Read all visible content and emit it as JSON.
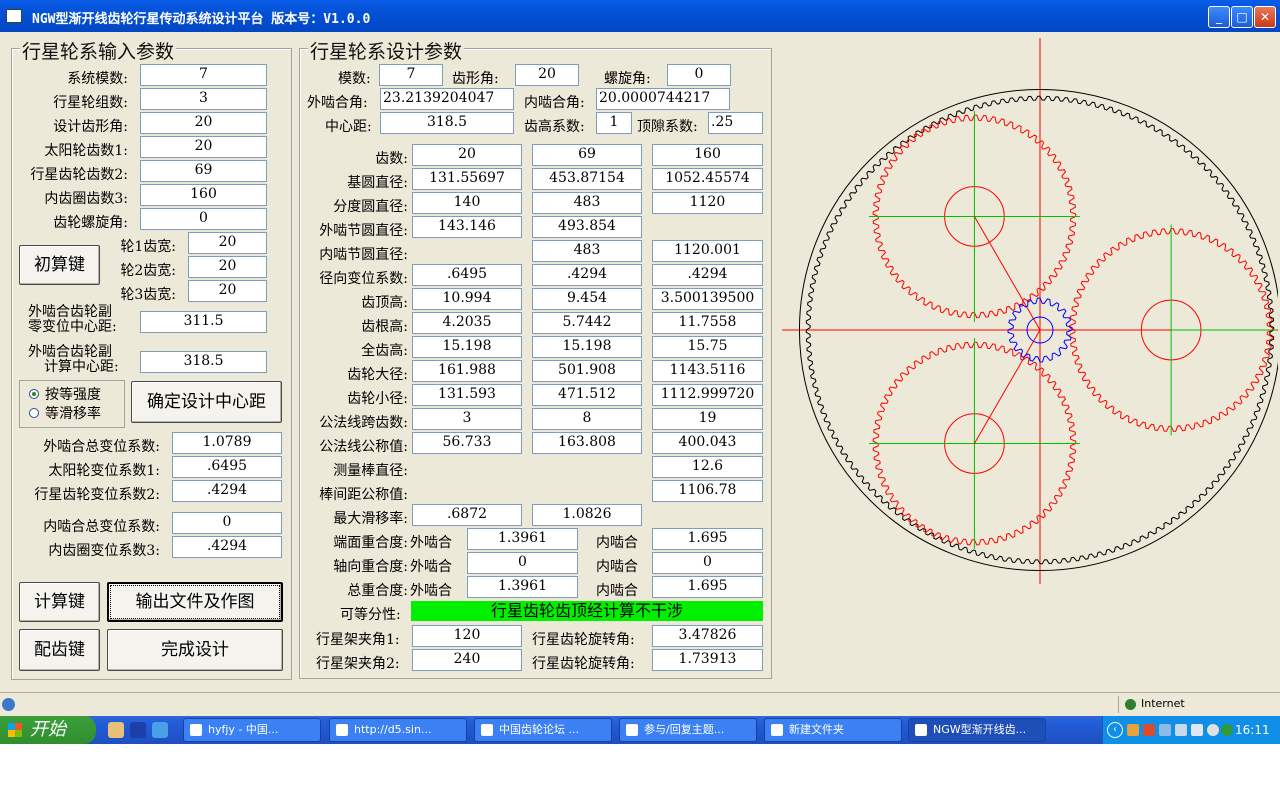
{
  "window": {
    "title": "NGW型渐开线齿轮行星传动系统设计平台   版本号：V1.0.0",
    "controls": {
      "minimize": "_",
      "maximize": "□",
      "close": "✕"
    }
  },
  "input_group": {
    "title": "行星轮系输入参数",
    "rows": [
      {
        "label": "系统模数:",
        "value": "7"
      },
      {
        "label": "行星轮组数:",
        "value": "3"
      },
      {
        "label": "设计齿形角:",
        "value": "20"
      },
      {
        "label": "太阳轮齿数1:",
        "value": "20"
      },
      {
        "label": "行星齿轮齿数2:",
        "value": "69"
      },
      {
        "label": "内齿圈齿数3:",
        "value": "160"
      },
      {
        "label": "齿轮螺旋角:",
        "value": "0"
      }
    ],
    "init_button": "初算键",
    "widths": [
      {
        "label": "轮1齿宽:",
        "value": "20"
      },
      {
        "label": "轮2齿宽:",
        "value": "20"
      },
      {
        "label": "轮3齿宽:",
        "value": "20"
      }
    ],
    "zero_center": {
      "label1": "外啮合齿轮副",
      "label2": "零变位中心距:",
      "value": "311.5"
    },
    "calc_center": {
      "label1": "外啮合齿轮副",
      "label2": "计算中心距:",
      "value": "318.5"
    },
    "radio_equal_strength": "按等强度",
    "radio_equal_slip": "等滑移率",
    "confirm_center_button": "确定设计中心距",
    "ext_total_shift": {
      "label": "外啮合总变位系数:",
      "value": "1.0789"
    },
    "sun_shift": {
      "label": "太阳轮变位系数1:",
      "value": ".6495"
    },
    "planet_shift": {
      "label": "行星齿轮变位系数2:",
      "value": ".4294"
    },
    "int_total_shift": {
      "label": "内啮合总变位系数:",
      "value": "0"
    },
    "ring_shift": {
      "label": "内齿圈变位系数3:",
      "value": ".4294"
    },
    "calc_button": "计算键",
    "output_button": "输出文件及作图",
    "match_button": "配齿键",
    "finish_button": "完成设计"
  },
  "design_group": {
    "title": "行星轮系设计参数",
    "module": {
      "label": "模数:",
      "value": "7"
    },
    "pressure_angle": {
      "label": "齿形角:",
      "value": "20"
    },
    "helix_angle": {
      "label": "螺旋角:",
      "value": "0"
    },
    "ext_mesh_angle": {
      "label": "外啮合角:",
      "value": "23.2139204047"
    },
    "int_mesh_angle": {
      "label": "内啮合角:",
      "value": "20.0000744217"
    },
    "center_distance": {
      "label": "中心距:",
      "value": "318.5"
    },
    "addendum_coef": {
      "label": "齿高系数:",
      "value": "1"
    },
    "clearance_coef": {
      "label": "顶隙系数:",
      "value": ".25"
    },
    "table": [
      {
        "label": "齿数:",
        "v": [
          "20",
          "69",
          "160"
        ]
      },
      {
        "label": "基圆直径:",
        "v": [
          "131.55697",
          "453.87154",
          "1052.45574"
        ]
      },
      {
        "label": "分度圆直径:",
        "v": [
          "140",
          "483",
          "1120"
        ]
      },
      {
        "label": "外啮节圆直径:",
        "v": [
          "143.146",
          "493.854",
          ""
        ]
      },
      {
        "label": "内啮节圆直径:",
        "v": [
          "",
          "483",
          "1120.001"
        ]
      },
      {
        "label": "径向变位系数:",
        "v": [
          ".6495",
          ".4294",
          ".4294"
        ]
      },
      {
        "label": "齿顶高:",
        "v": [
          "10.994",
          "9.454",
          "3.500139500"
        ]
      },
      {
        "label": "齿根高:",
        "v": [
          "4.2035",
          "5.7442",
          "11.7558"
        ]
      },
      {
        "label": "全齿高:",
        "v": [
          "15.198",
          "15.198",
          "15.75"
        ]
      },
      {
        "label": "齿轮大径:",
        "v": [
          "161.988",
          "501.908",
          "1143.5116"
        ]
      },
      {
        "label": "齿轮小径:",
        "v": [
          "131.593",
          "471.512",
          "1112.999720"
        ]
      },
      {
        "label": "公法线跨齿数:",
        "v": [
          "3",
          "8",
          "19"
        ]
      },
      {
        "label": "公法线公称值:",
        "v": [
          "56.733",
          "163.808",
          "400.043"
        ]
      },
      {
        "label": "测量棒直径:",
        "v": [
          "",
          "",
          "12.6"
        ]
      },
      {
        "label": "棒间距公称值:",
        "v": [
          "",
          "",
          "1106.78"
        ]
      },
      {
        "label": "最大滑移率:",
        "v": [
          ".6872",
          "1.0826",
          ""
        ]
      }
    ],
    "contact_rows": [
      {
        "label": "端面重合度:",
        "ext_label": "外啮合",
        "ext": "1.3961",
        "int_label": "内啮合",
        "int": "1.695"
      },
      {
        "label": "轴向重合度:",
        "ext_label": "外啮合",
        "ext": "0",
        "int_label": "内啮合",
        "int": "0"
      },
      {
        "label": "总重合度:",
        "ext_label": "外啮合",
        "ext": "1.3961",
        "int_label": "内啮合",
        "int": "1.695"
      }
    ],
    "divisibility_label": "可等分性:",
    "divisibility_result": "行星齿轮齿顶经计算不干涉",
    "carrier_angle1": {
      "label": "行星架夹角1:",
      "value": "120"
    },
    "carrier_angle2": {
      "label": "行星架夹角2:",
      "value": "240"
    },
    "planet_rot1": {
      "label": "行星齿轮旋转角:",
      "value": "3.47826"
    },
    "planet_rot2": {
      "label": "行星齿轮旋转角:",
      "value": "1.73913"
    }
  },
  "drawing": {
    "sun_teeth": 20,
    "planet_teeth": 69,
    "ring_teeth": 160,
    "planet_count": 3,
    "sun_color": "#0000ff",
    "planet_color": "#ff0000",
    "ring_color": "#000000",
    "axis_color": "#ff0000",
    "planet_axis_color": "#00c000"
  },
  "statusbar": {
    "zone": "Internet"
  },
  "taskbar": {
    "start": "开始",
    "tasks": [
      "hyfjy - 中国...",
      "http://d5.sin...",
      "中国齿轮论坛 ...",
      "参与/回复主题...",
      "新建文件夹",
      "NGW型渐开线齿..."
    ],
    "clock": "16:11"
  }
}
